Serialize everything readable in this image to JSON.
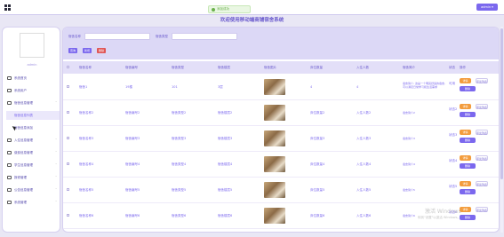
{
  "header": {
    "toast": "添加成功",
    "admin_label": "admin ▾",
    "title": "欢迎使用移动端商铺宿舍系统"
  },
  "sidebar": {
    "username": "admin",
    "items": [
      {
        "label": "系统首页"
      },
      {
        "label": "系统用户"
      },
      {
        "label": "宿舍信息管理",
        "chevron": "˄"
      },
      {
        "label": "宿舍信息列表",
        "sub": true,
        "active": true
      },
      {
        "label": "宿舍信息添加",
        "sub": true
      },
      {
        "label": "入住信息管理",
        "chevron": "˅"
      },
      {
        "label": "缴费信息管理",
        "chevron": "˅"
      },
      {
        "label": "学生信息管理",
        "chevron": "˅"
      },
      {
        "label": "报修管理",
        "chevron": "˅"
      },
      {
        "label": "公告信息管理",
        "chevron": "˅"
      },
      {
        "label": "系统管理",
        "chevron": "˅"
      }
    ]
  },
  "search": {
    "label1": "宿舍名称",
    "label2": "宿舍类型",
    "query_btn": "查询",
    "add_btn": "新增",
    "delete_btn": "删除"
  },
  "table": {
    "headers": [
      "宿舍名称",
      "宿舍编号",
      "宿舍类型",
      "宿舍楼层",
      "宿舍图片",
      "床位数量",
      "入住人数",
      "宿舍简介",
      "状态",
      "操作"
    ],
    "rows": [
      {
        "name": "宿舍1",
        "code": "19楼",
        "type": "101",
        "floor": "3层",
        "beds": "4",
        "people": "4",
        "intro": "宿舍简介: 这是一个明亮舒适的宿舍, 可以满足日常学习和生活需求",
        "status": "可用"
      },
      {
        "name": "宿舍名称2",
        "code": "宿舍编号2",
        "type": "宿舍类型2",
        "floor": "宿舍楼层2",
        "beds": "床位数量2",
        "people": "入住人数2",
        "intro": "宿舍简介2",
        "status": "状态2"
      },
      {
        "name": "宿舍名称3",
        "code": "宿舍编号3",
        "type": "宿舍类型3",
        "floor": "宿舍楼层3",
        "beds": "床位数量3",
        "people": "入住人数3",
        "intro": "宿舍简介3",
        "status": "状态3"
      },
      {
        "name": "宿舍名称4",
        "code": "宿舍编号4",
        "type": "宿舍类型4",
        "floor": "宿舍楼层4",
        "beds": "床位数量4",
        "people": "入住人数4",
        "intro": "宿舍简介4",
        "status": "状态4"
      },
      {
        "name": "宿舍名称5",
        "code": "宿舍编号5",
        "type": "宿舍类型5",
        "floor": "宿舍楼层5",
        "beds": "床位数量5",
        "people": "入住人数5",
        "intro": "宿舍简介5",
        "status": "状态5"
      },
      {
        "name": "宿舍名称6",
        "code": "宿舍编号6",
        "type": "宿舍类型6",
        "floor": "宿舍楼层6",
        "beds": "床位数量6",
        "people": "入住人数6",
        "intro": "宿舍简介6",
        "status": "状态6"
      }
    ],
    "view_btn": "详情",
    "review_btn": "评论列表",
    "delete_btn": "删除"
  },
  "watermark": {
    "line1": "激活 Windows",
    "line2": "转到\"设置\"以激活 Windows。"
  },
  "colors": {
    "accent": "#7b68ee",
    "orange": "#f39c3d",
    "bg": "#e9e7f5"
  }
}
